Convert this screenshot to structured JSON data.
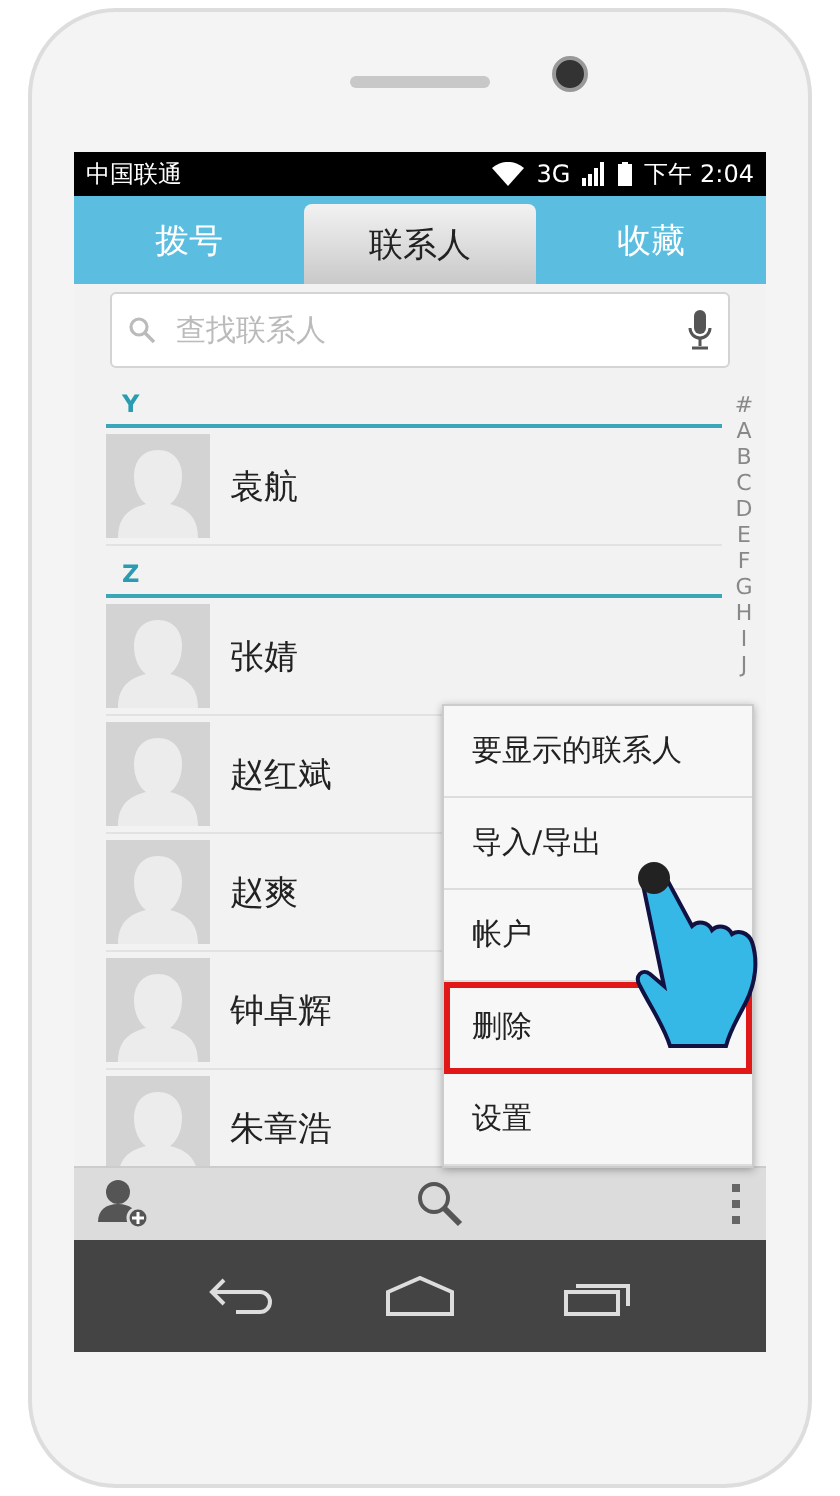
{
  "status_bar": {
    "carrier": "中国联通",
    "network": "3G",
    "time": "下午 2:04"
  },
  "tabs": [
    {
      "label": "拨号",
      "selected": false
    },
    {
      "label": "联系人",
      "selected": true
    },
    {
      "label": "收藏",
      "selected": false
    }
  ],
  "search": {
    "placeholder": "查找联系人"
  },
  "sections": [
    {
      "letter": "Y",
      "contacts": [
        "袁航"
      ]
    },
    {
      "letter": "Z",
      "contacts": [
        "张婧",
        "赵红斌",
        "赵爽",
        "钟卓辉",
        "朱章浩"
      ]
    }
  ],
  "index": [
    "#",
    "A",
    "B",
    "C",
    "D",
    "E",
    "F",
    "G",
    "H",
    "I",
    "J"
  ],
  "menu": [
    {
      "label": "要显示的联系人",
      "highlighted": false
    },
    {
      "label": "导入/导出",
      "highlighted": false
    },
    {
      "label": "帐户",
      "highlighted": false
    },
    {
      "label": "删除",
      "highlighted": true
    },
    {
      "label": "设置",
      "highlighted": false
    }
  ]
}
